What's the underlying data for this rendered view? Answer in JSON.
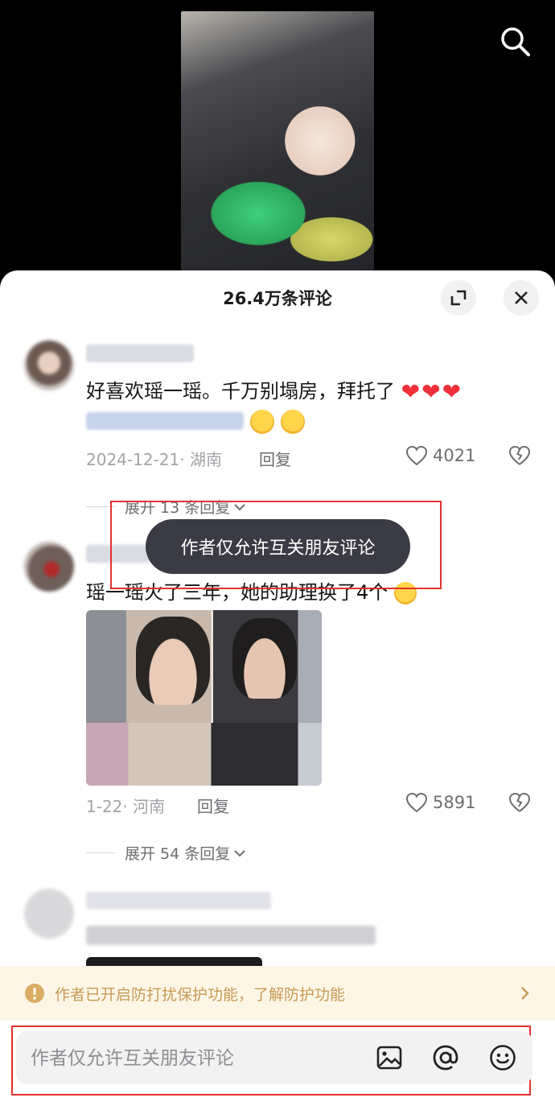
{
  "sheet": {
    "title": "26.4万条评论"
  },
  "comments": [
    {
      "text": "好喜欢瑶一瑶。千万别塌房，拜托了",
      "date_location": "2024-12-21· 湖南",
      "reply_label": "回复",
      "likes": "4021",
      "expand_label": "展开 13 条回复"
    },
    {
      "text": "瑶一瑶火了三年，她的助理换了4个",
      "date_location": "1-22· 河南",
      "reply_label": "回复",
      "likes": "5891",
      "expand_label": "展开 54 条回复"
    }
  ],
  "toast": {
    "text": "作者仅允许互关朋友评论"
  },
  "notice": {
    "text": "作者已开启防打扰保护功能，了解防护功能"
  },
  "comment_input": {
    "placeholder": "作者仅允许互关朋友评论"
  },
  "colors": {
    "highlight": "#e3312e",
    "notice_text": "#c89a53",
    "heart_red": "#f0313b"
  }
}
